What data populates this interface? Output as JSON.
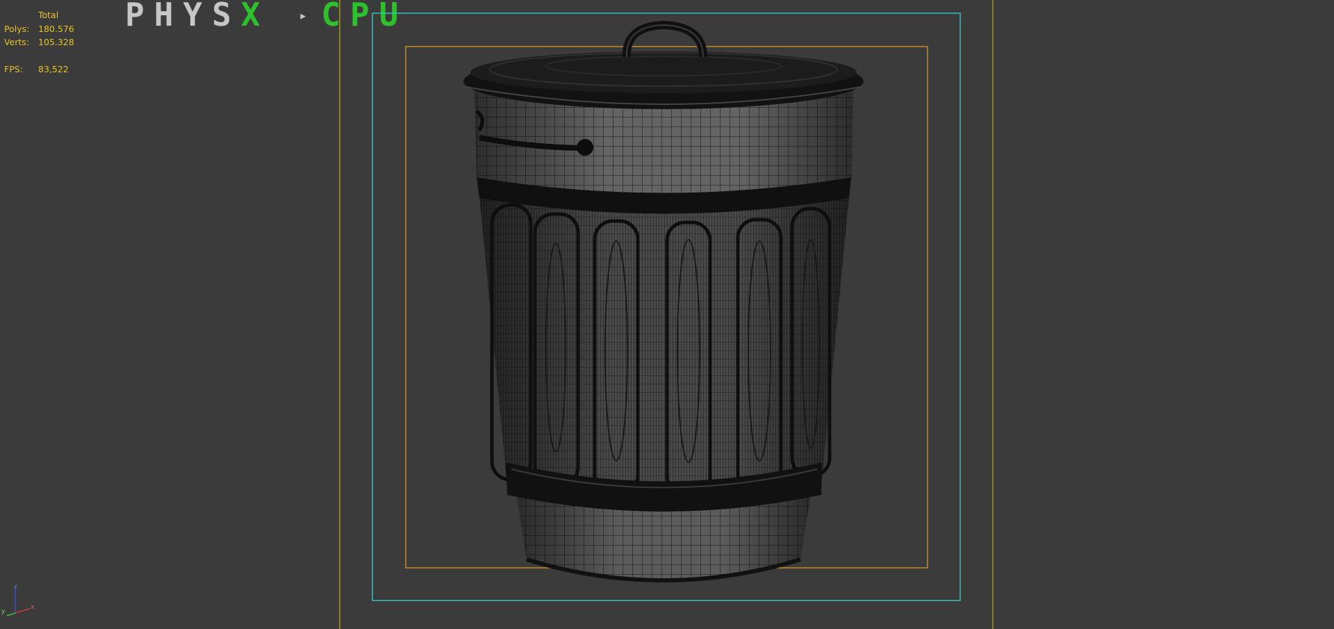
{
  "stats": {
    "header": "Total",
    "polys_label": "Polys:",
    "polys_value": "180.576",
    "verts_label": "Verts:",
    "verts_value": "105.328",
    "fps_label": "FPS:",
    "fps_value": "83,522"
  },
  "physx": {
    "part1": "PHYS",
    "part2": "X",
    "arrow": "▸",
    "part3": "CPU"
  },
  "axis": {
    "x": "x",
    "y": "y",
    "z": "z"
  },
  "colors": {
    "background": "#3b3b3b",
    "stats_text": "#e7c22c",
    "safe_frame_outer": "#d9c21e",
    "safe_frame_action": "#38c8c8",
    "safe_frame_title": "#e7a123",
    "physx_green": "#2ec12b",
    "wire": "#141414",
    "mesh_fill": "#585858"
  }
}
